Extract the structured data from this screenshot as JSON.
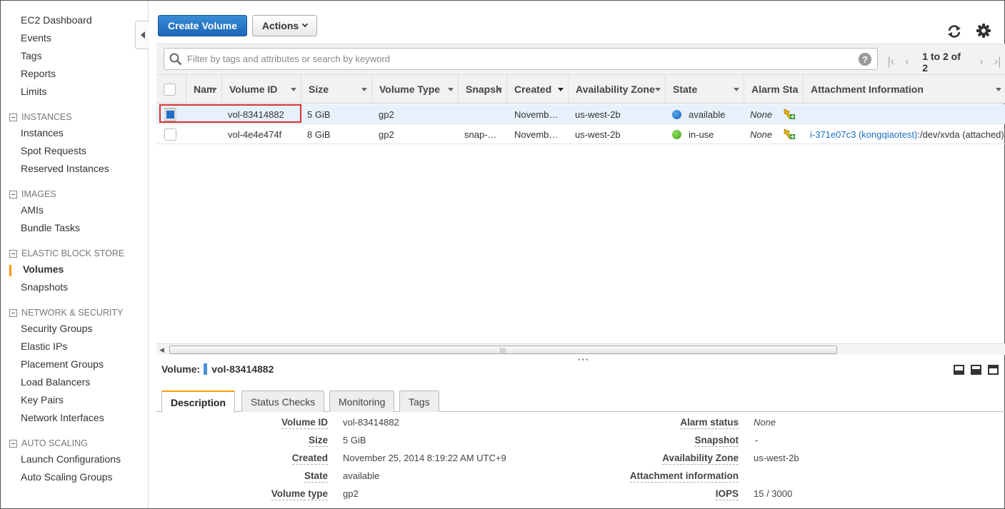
{
  "sidebar": {
    "top_items": [
      "EC2 Dashboard",
      "Events",
      "Tags",
      "Reports",
      "Limits"
    ],
    "sections": [
      {
        "title": "INSTANCES",
        "items": [
          "Instances",
          "Spot Requests",
          "Reserved Instances"
        ]
      },
      {
        "title": "IMAGES",
        "items": [
          "AMIs",
          "Bundle Tasks"
        ]
      },
      {
        "title": "ELASTIC BLOCK STORE",
        "items": [
          "Volumes",
          "Snapshots"
        ]
      },
      {
        "title": "NETWORK & SECURITY",
        "items": [
          "Security Groups",
          "Elastic IPs",
          "Placement Groups",
          "Load Balancers",
          "Key Pairs",
          "Network Interfaces"
        ]
      },
      {
        "title": "AUTO SCALING",
        "items": [
          "Launch Configurations",
          "Auto Scaling Groups"
        ]
      }
    ],
    "active_item": "Volumes"
  },
  "toolbar": {
    "create_label": "Create Volume",
    "actions_label": "Actions"
  },
  "search": {
    "placeholder": "Filter by tags and attributes or search by keyword",
    "help": "?",
    "pagination": "1 to 2 of 2"
  },
  "table": {
    "columns": [
      "Nam",
      "Volume ID",
      "Size",
      "Volume Type",
      "Snapsh",
      "Created",
      "Availability Zone",
      "State",
      "Alarm Sta",
      "Attachment Information"
    ],
    "rows": [
      {
        "name": "",
        "volume_id": "vol-83414882",
        "size": "5 GiB",
        "volume_type": "gp2",
        "snapshot": "",
        "created": "Novemb…",
        "zone": "us-west-2b",
        "state": "available",
        "state_color": "#1f6fc5",
        "alarm": "None",
        "attachment_link": "",
        "attachment_rest": "",
        "selected": true
      },
      {
        "name": "",
        "volume_id": "vol-4e4e474f",
        "size": "8 GiB",
        "volume_type": "gp2",
        "snapshot": "snap-…",
        "created": "Novemb…",
        "zone": "us-west-2b",
        "state": "in-use",
        "state_color": "#3fa31a",
        "alarm": "None",
        "attachment_link": "i-371e07c3 (kongqiaotest)",
        "attachment_rest": ":/dev/xvda (attached)",
        "selected": false
      }
    ]
  },
  "detail": {
    "title_prefix": "Volume:",
    "title_id": "vol-83414882",
    "tabs": [
      "Description",
      "Status Checks",
      "Monitoring",
      "Tags"
    ],
    "active_tab": "Description",
    "left_fields": [
      {
        "label": "Volume ID",
        "value": "vol-83414882"
      },
      {
        "label": "Size",
        "value": "5 GiB"
      },
      {
        "label": "Created",
        "value": "November 25, 2014 8:19:22 AM UTC+9"
      },
      {
        "label": "State",
        "value": "available"
      },
      {
        "label": "Volume type",
        "value": "gp2"
      }
    ],
    "right_fields": [
      {
        "label": "Alarm status",
        "value": "None"
      },
      {
        "label": "Snapshot",
        "value": "-"
      },
      {
        "label": "Availability Zone",
        "value": "us-west-2b"
      },
      {
        "label": "Attachment information",
        "value": ""
      },
      {
        "label": "IOPS",
        "value": "15 / 3000"
      }
    ]
  },
  "colors": {
    "accent": "#f90",
    "primary_button": "#1a66b8",
    "link": "#1a6fc0"
  }
}
